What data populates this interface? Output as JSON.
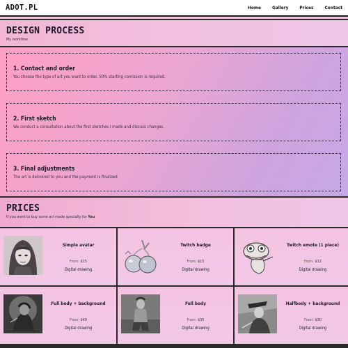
{
  "brand": {
    "logo": "ADOT.PL"
  },
  "nav": {
    "items": [
      "Home",
      "Gallery",
      "Prices",
      "Contact"
    ]
  },
  "design": {
    "title": "DESIGN PROCESS",
    "subtitle": "My workflow",
    "steps": [
      {
        "title": "1. Contact and order",
        "desc": "You choose the type of art you want to order. 50% starting comission is required."
      },
      {
        "title": "2. First sketch",
        "desc": "We conduct a consultation about the first sketches I made and discuss changes."
      },
      {
        "title": "3. Final adjustments",
        "desc": "The art is delivered to you and the payment is finalized"
      }
    ]
  },
  "prices": {
    "title": "PRICES",
    "subtitle_prefix": "If you want to buy some art made specially for ",
    "subtitle_emph": "You",
    "from_label": "From:",
    "cards": [
      {
        "title": "Simple avatar",
        "price": "$15",
        "type": "Digital drawing"
      },
      {
        "title": "Twitch badge",
        "price": "$15",
        "type": "Digital drawing"
      },
      {
        "title": "Twitch emote (1 piece)",
        "price": "$12",
        "type": "Digital drawing"
      },
      {
        "title": "Full body + background",
        "price": "$40",
        "type": "Digital drawing"
      },
      {
        "title": "Full body",
        "price": "$35",
        "type": "Digital drawing"
      },
      {
        "title": "Halfbody + background",
        "price": "$30",
        "type": "Digital drawing"
      }
    ]
  }
}
